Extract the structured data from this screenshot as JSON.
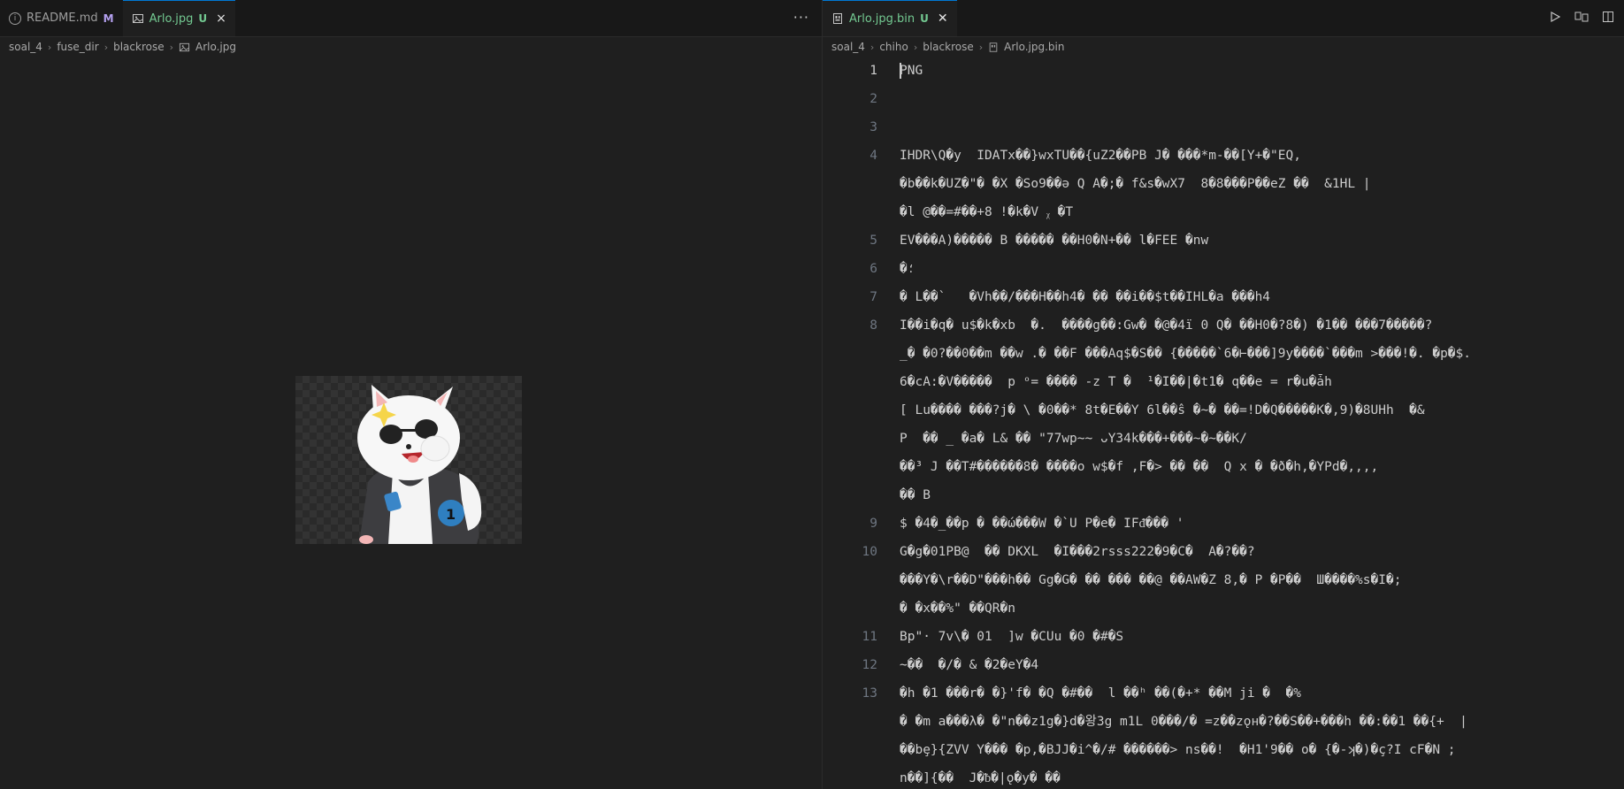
{
  "left_pane": {
    "tabs": [
      {
        "label": "README.md",
        "badge": "M",
        "icon": "info-icon",
        "active": false
      },
      {
        "label": "Arlo.jpg",
        "badge": "U",
        "icon": "image-icon",
        "active": true
      }
    ],
    "more_actions": "···",
    "breadcrumb": [
      "soal_4",
      "fuse_dir",
      "blackrose",
      "Arlo.jpg"
    ]
  },
  "right_pane": {
    "tab": {
      "label": "Arlo.jpg.bin",
      "badge": "U",
      "icon": "binary-file-icon"
    },
    "actions": [
      "run-icon",
      "compare-changes-icon",
      "split-editor-icon"
    ],
    "breadcrumb": [
      "soal_4",
      "chiho",
      "blackrose",
      "Arlo.jpg.bin"
    ],
    "lines": [
      {
        "num": "1",
        "text": "PNG"
      },
      {
        "num": "2",
        "text": ""
      },
      {
        "num": "3",
        "text": ""
      },
      {
        "num": "4",
        "text": "IHDR\\Q�y  IDATx��}wxTU��{uZ2��PB J� ���*m-��[Y+�\"EQ,"
      },
      {
        "num": "",
        "text": "�b��k�UZ�\"� �X �Ѕo9��ə Q A�;� f&s�wX7  8�8���P��eZ ��  &1HL |"
      },
      {
        "num": "",
        "text": "�l @��=#��+8 !�k�V ᵪ �T"
      },
      {
        "num": "5",
        "text": "EV���A)����� B ����� ��H0�N+�� l�FEE �nw"
      },
      {
        "num": "6",
        "text": "�؛"
      },
      {
        "num": "7",
        "text": "� L��`   �Vh��/���H��h4� �� ��i��$t��IHL�a ���h4"
      },
      {
        "num": "8",
        "text": "I��i�q� u$�k�xb  �.  ����g��:Gw� �@�4ï 0 Q� ��H0�?8�) �1�� ���7�����?"
      },
      {
        "num": "",
        "text": "_� �0?��0��m ��w .� ��F ���Aq$�S�� {�����`6�⊢���]9y����`���m >���!�. �p�$."
      },
      {
        "num": "",
        "text": "6�cA:�V�����  p ᵒ= ���� -z T �  ¹�I��|�t1� q��e = r�u�ǡh"
      },
      {
        "num": "",
        "text": "[ Lu���� ���?j� \\ �0��* 8t�E��Y 6l��ŝ �~� ��=!D�Q�����K�,9)�8UHh  �&"
      },
      {
        "num": "",
        "text": "P  �� _ �a� L& �� \"77wp~~ ᴗY34k���+���~�~��K/"
      },
      {
        "num": "",
        "text": "��³ J ��T#������8� ����o w$�f ,F�> �� ��  Q x � �ð�h,�YPd�,,,,"
      },
      {
        "num": "",
        "text": "�� B"
      },
      {
        "num": "9",
        "text": "$ �4�_��p � ��ώ���W �`U P�e� IFᵭ��� '"
      },
      {
        "num": "10",
        "text": "G�g�01PB@  �� DKXL  �I���2rsss222�9�C�  A�?��?"
      },
      {
        "num": "",
        "text": "���Y�\\r��D\"���h�� Gg�G� �� ��� ��@ ��AW�Z 8,� P �P��  Ш����%s�I�;"
      },
      {
        "num": "",
        "text": "� �x��%\" ��QR�n"
      },
      {
        "num": "11",
        "text": "Bp\"· 7v\\� 01  ]w �CUu �0 �#�S"
      },
      {
        "num": "12",
        "text": "~��  �/� & �2�eY�4"
      },
      {
        "num": "13",
        "text": "�h �1 ���r� �}'f� �Q �#��  l ��ʰ ��(�+* ��M ji �  �%"
      },
      {
        "num": "",
        "text": "� �m a���λ� �\"n��z1g�}d�왕3g m1L 0���/� =z��zǫн�?��S��+���h ��:��1 ��{+  |"
      },
      {
        "num": "",
        "text": "��bȩ}{ZVV Y��� �p,�BJJ�i^�/# ������> ns��!  �H1'9�� o� {�-ʞ�)�ç?I cF�N ;"
      },
      {
        "num": "",
        "text": "n��]{��  J�ᵬ�|ǫ�y� ��"
      }
    ]
  },
  "colors": {
    "background": "#1f1f1f",
    "tab_bar": "#181818",
    "modified_badge": "#b4a0f0",
    "untracked_badge": "#73c991",
    "control_char_bg": "#a1050a",
    "active_tab_border": "#0078d4"
  }
}
